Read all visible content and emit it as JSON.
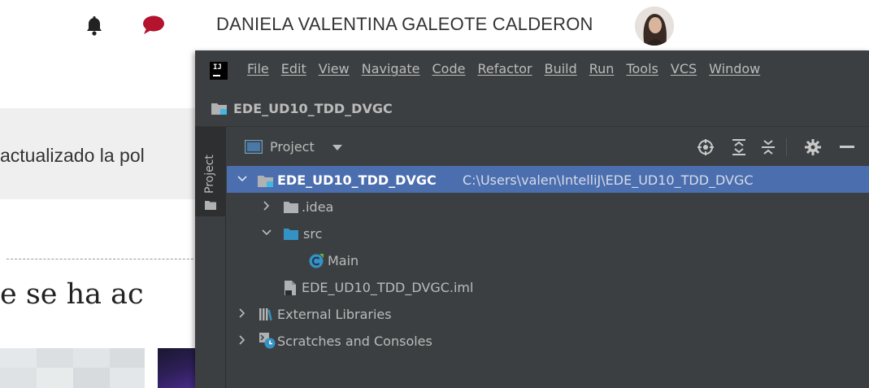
{
  "web": {
    "user_name": "DANIELA VALENTINA GALEOTE CALDERON",
    "notice_fragment": "actualizado la pol",
    "heading_fragment": "e se ha ac"
  },
  "ide": {
    "menu": [
      "File",
      "Edit",
      "View",
      "Navigate",
      "Code",
      "Refactor",
      "Build",
      "Run",
      "Tools",
      "VCS",
      "Window"
    ],
    "project_title": "EDE_UD10_TDD_DVGC",
    "side_tab_label": "Project",
    "panel_title": "Project",
    "tree": {
      "root": {
        "name": "EDE_UD10_TDD_DVGC",
        "path": "C:\\Users\\valen\\IntelliJ\\EDE_UD10_TDD_DVGC"
      },
      "idea": ".idea",
      "src": "src",
      "main": "Main",
      "iml": "EDE_UD10_TDD_DVGC.iml",
      "external_libraries": "External Libraries",
      "scratches": "Scratches and Consoles"
    },
    "icons": {
      "locate": "crosshair-icon",
      "expand_all": "expand-all-icon",
      "collapse_all": "collapse-all-icon",
      "settings": "gear-icon",
      "hide": "minimize-icon"
    },
    "colors": {
      "bg": "#3c3f41",
      "selection": "#4b6eaf",
      "text": "#bbbbbb",
      "folder": "#afb1b3",
      "source_folder": "#3592c4",
      "module_blue": "#40b6e0"
    }
  }
}
